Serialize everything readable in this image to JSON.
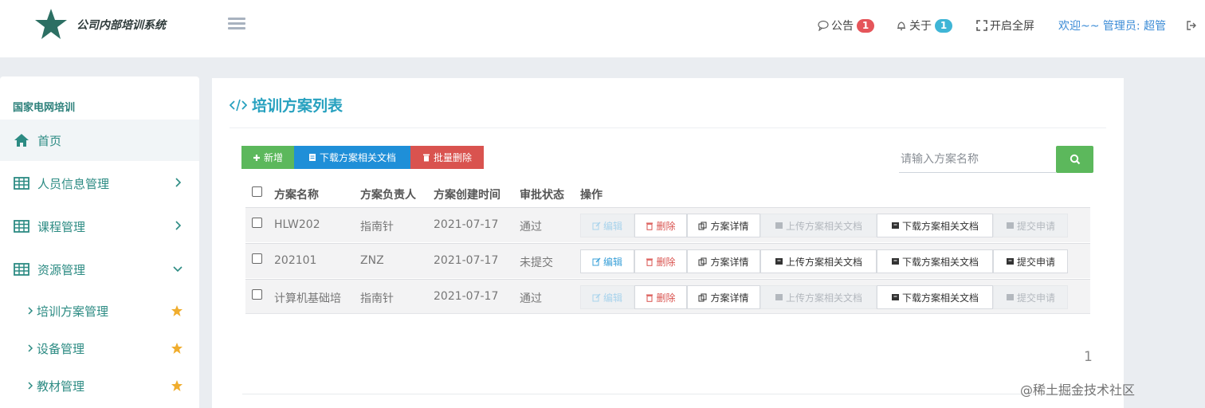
{
  "header": {
    "logo_text": "公司内部培训系统",
    "notice_label": "公告",
    "notice_count": "1",
    "about_label": "关于",
    "about_count": "1",
    "fullscreen_label": "开启全屏",
    "welcome_text": "欢迎~~ 管理员: 超管"
  },
  "sidebar": {
    "title": "国家电网培训",
    "items": [
      {
        "label": "首页"
      },
      {
        "label": "人员信息管理"
      },
      {
        "label": "课程管理"
      },
      {
        "label": "资源管理"
      }
    ],
    "sub_items": [
      {
        "label": "培训方案管理"
      },
      {
        "label": "设备管理"
      },
      {
        "label": "教材管理"
      }
    ]
  },
  "main": {
    "title": "培训方案列表",
    "toolbar": {
      "add_label": "新增",
      "download_label": "下载方案相关文档",
      "batch_delete_label": "批量删除"
    },
    "search": {
      "placeholder": "请输入方案名称"
    },
    "columns": [
      "方案名称",
      "方案负责人",
      "方案创建时间",
      "审批状态",
      "操作"
    ],
    "rows": [
      {
        "name": "HLW202",
        "owner": "指南针",
        "created": "2021-07-17",
        "status": "通过"
      },
      {
        "name": "202101",
        "owner": "ZNZ",
        "created": "2021-07-17",
        "status": "未提交"
      },
      {
        "name": "计算机基础培",
        "owner": "指南针",
        "created": "2021-07-17",
        "status": "通过"
      }
    ],
    "actions": {
      "edit": "编辑",
      "delete": "删除",
      "detail": "方案详情",
      "upload": "上传方案相关文档",
      "download": "下载方案相关文档",
      "submit": "提交申请"
    },
    "pagination": {
      "current": "1"
    }
  },
  "watermark": "@稀土掘金技术社区",
  "colors": {
    "accent": "#27a1bf",
    "sidebar_text": "#2c8b83",
    "success": "#5cb85c",
    "primary": "#1f8fd8",
    "danger": "#d9534f"
  }
}
